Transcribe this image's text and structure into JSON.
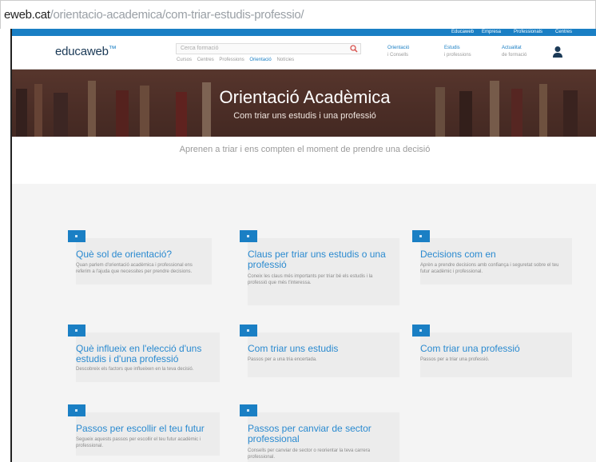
{
  "browser": {
    "url_host": "eweb.cat",
    "url_path": "/orientacio-academica/com-triar-estudis-professio/"
  },
  "topbar": {
    "links": [
      "Educaweb",
      "Empresa",
      "Professionals",
      "Centres"
    ]
  },
  "header": {
    "logo_text": "educaweb",
    "logo_mark": "™",
    "search_placeholder": "Cerca formació",
    "filters": [
      "Cursos",
      "Centres",
      "Professions",
      "Orientació",
      "Notícies"
    ],
    "active_filter": "Orientació",
    "links": [
      {
        "title": "Orientació",
        "subtitle": "i Consells"
      },
      {
        "title": "Estudis",
        "subtitle": "i professions"
      },
      {
        "title": "Actualitat",
        "subtitle": "de formació"
      }
    ]
  },
  "hero": {
    "title": "Orientació Acadèmica",
    "subtitle": "Com triar uns estudis i una professió"
  },
  "intro": "Aprenen a triar i ens compten el moment de prendre una decisió",
  "cards": [
    {
      "title": "Què sol de orientació?",
      "desc": "Quan parlem d'orientació acadèmica i professional ens referim a l'ajuda que necessites per prendre decisions."
    },
    {
      "title": "Claus per triar uns estudis o una professió",
      "desc": "Coneix les claus més importants per triar bé els estudis i la professió que més t'interessa."
    },
    {
      "title": "Decisions com en",
      "desc": "Aprèn a prendre decisions amb confiança i seguretat sobre el teu futur acadèmic i professional."
    },
    {
      "title": "Què influeix en l'elecció d'uns estudis i d'una professió",
      "desc": "Descobreix els factors que influeixen en la teva decisió."
    },
    {
      "title": "Com triar uns estudis",
      "desc": "Passos per a una tria encertada."
    },
    {
      "title": "Com triar una professió",
      "desc": "Passos per a triar una professió."
    },
    {
      "title": "Passos per escollir el teu futur",
      "desc": "Segueix aquests passos per escollir el teu futur acadèmic i professional."
    },
    {
      "title": "Passos per canviar de sector professional",
      "desc": "Consells per canviar de sector o reorientar la teva carrera professional."
    }
  ],
  "colors": {
    "accent": "#1a7fc4",
    "hero": "#6d463c",
    "card_bg": "#ececec"
  }
}
